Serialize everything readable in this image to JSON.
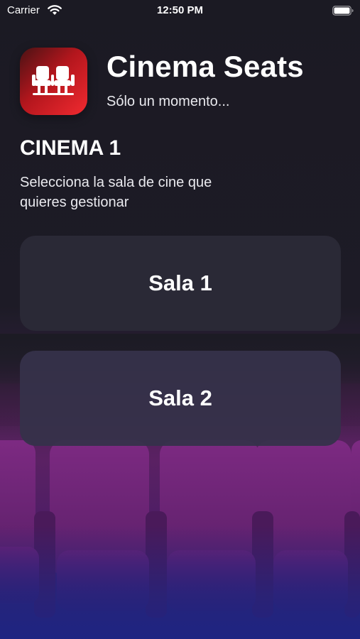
{
  "status_bar": {
    "carrier": "Carrier",
    "time": "12:50 PM"
  },
  "header": {
    "app_title": "Cinema Seats",
    "subtitle": "Sólo un momento..."
  },
  "cinema": {
    "name": "CINEMA 1",
    "instructions": "Selecciona la sala de cine que quieres gestionar"
  },
  "rooms": [
    {
      "label": "Sala 1"
    },
    {
      "label": "Sala 2"
    }
  ],
  "colors": {
    "background": "#1c1b24",
    "button": "#2a2936",
    "button_alt": "#36324a",
    "icon_red": "#f12a30",
    "seat_purple": "#6a2070"
  },
  "icons": {
    "app": "cinema-seats-icon",
    "wifi": "wifi-icon",
    "battery": "battery-icon"
  }
}
